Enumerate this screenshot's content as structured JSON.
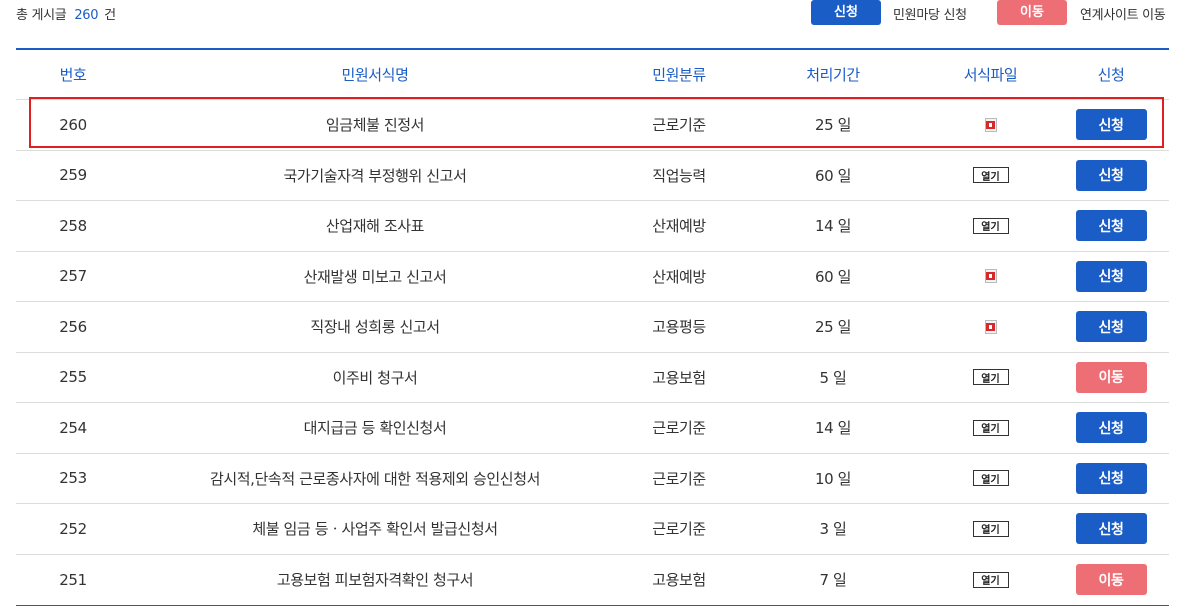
{
  "summary": {
    "prefix": "총 게시글",
    "count": "260",
    "suffix": "건"
  },
  "legend": {
    "apply_label": "신청",
    "apply_desc": "민원마당 신청",
    "move_label": "이동",
    "move_desc": "연계사이트 이동"
  },
  "columns": [
    "번호",
    "민원서식명",
    "민원분류",
    "처리기간",
    "서식파일",
    "신청"
  ],
  "rows": [
    {
      "no": "260",
      "name": "임금체불 진정서",
      "category": "근로기준",
      "days": "25 일",
      "file": "hwp-icon",
      "action": "신청",
      "action_type": "apply"
    },
    {
      "no": "259",
      "name": "국가기술자격 부정행위 신고서",
      "category": "직업능력",
      "days": "60 일",
      "file": "열기",
      "action": "신청",
      "action_type": "apply"
    },
    {
      "no": "258",
      "name": "산업재해 조사표",
      "category": "산재예방",
      "days": "14 일",
      "file": "열기",
      "action": "신청",
      "action_type": "apply"
    },
    {
      "no": "257",
      "name": "산재발생 미보고 신고서",
      "category": "산재예방",
      "days": "60 일",
      "file": "hwp-icon",
      "action": "신청",
      "action_type": "apply"
    },
    {
      "no": "256",
      "name": "직장내 성희롱 신고서",
      "category": "고용평등",
      "days": "25 일",
      "file": "hwp-icon",
      "action": "신청",
      "action_type": "apply"
    },
    {
      "no": "255",
      "name": "이주비 청구서",
      "category": "고용보험",
      "days": "5 일",
      "file": "열기",
      "action": "이동",
      "action_type": "move"
    },
    {
      "no": "254",
      "name": "대지급금 등 확인신청서",
      "category": "근로기준",
      "days": "14 일",
      "file": "열기",
      "action": "신청",
      "action_type": "apply"
    },
    {
      "no": "253",
      "name": "감시적,단속적 근로종사자에 대한 적용제외 승인신청서",
      "category": "근로기준",
      "days": "10 일",
      "file": "열기",
      "action": "신청",
      "action_type": "apply"
    },
    {
      "no": "252",
      "name": "체불 임금 등ㆍ사업주 확인서 발급신청서",
      "category": "근로기준",
      "days": "3 일",
      "file": "열기",
      "action": "신청",
      "action_type": "apply"
    },
    {
      "no": "251",
      "name": "고용보험 피보험자격확인 청구서",
      "category": "고용보험",
      "days": "7 일",
      "file": "열기",
      "action": "이동",
      "action_type": "move"
    }
  ],
  "colors": {
    "accent_blue": "#1a5dc7",
    "move_red": "#ee6e76",
    "highlight_red": "#e02020"
  }
}
